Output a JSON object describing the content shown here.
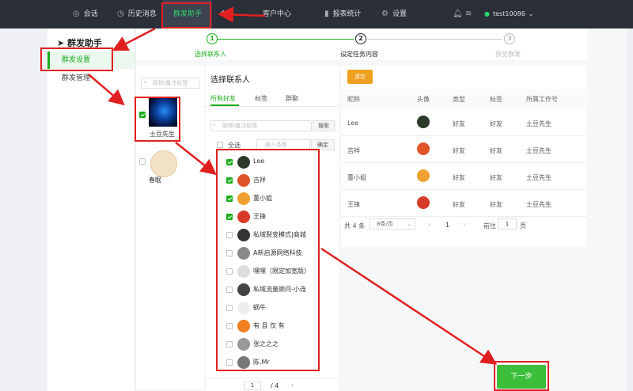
{
  "topbar": {
    "nav": [
      {
        "label": "会话",
        "icon": "chat-icon"
      },
      {
        "label": "历史消息",
        "icon": "clock-icon"
      },
      {
        "label": "群发助手",
        "icon": ""
      },
      {
        "label": "客户中心",
        "icon": "settings-icon"
      },
      {
        "label": "报表统计",
        "icon": "bar-chart-icon"
      },
      {
        "label": "设置",
        "icon": "gear-icon"
      }
    ],
    "username": "test10086"
  },
  "sidebar": {
    "title": "群发助手",
    "items": [
      {
        "label": "群发设置",
        "selected": true
      },
      {
        "label": "群发管理",
        "selected": false
      }
    ]
  },
  "steps": [
    {
      "num": "1",
      "label": "选择联系人",
      "state": "done"
    },
    {
      "num": "2",
      "label": "设定任务内容",
      "state": "active"
    },
    {
      "num": "3",
      "label": "预览群发",
      "state": "todo"
    }
  ],
  "accounts": {
    "search_placeholder": "昵称/备注标签",
    "items": [
      {
        "name": "土豆先生",
        "checked": true
      },
      {
        "name": "春眠",
        "checked": false
      }
    ]
  },
  "contacts": {
    "title": "选择联系人",
    "tabs": [
      "所有好友",
      "标签",
      "群聊"
    ],
    "search_placeholder": "昵称/备注标签",
    "search_button": "搜索",
    "select_all": "全选",
    "count_placeholder": "输入条数",
    "confirm_button": "确定",
    "list": [
      {
        "name": "Lee",
        "checked": true,
        "color": "#2b3a2b"
      },
      {
        "name": "吉祥",
        "checked": true,
        "color": "#e0542a"
      },
      {
        "name": "董小姐",
        "checked": true,
        "color": "#f0a030"
      },
      {
        "name": "王锋",
        "checked": true,
        "color": "#d83a2a"
      },
      {
        "name": "私域裂变模式|商城",
        "checked": false,
        "color": "#333333"
      },
      {
        "name": "A新启源网络科技",
        "checked": false,
        "color": "#8a8a8a"
      },
      {
        "name": "嘿嘿（限定加宽版）",
        "checked": false,
        "color": "#dddddd"
      },
      {
        "name": "私域流量顾问-小连",
        "checked": false,
        "color": "#444444"
      },
      {
        "name": "蜗牛",
        "checked": false,
        "color": "#eeeeee"
      },
      {
        "name": "有 且 仅 有",
        "checked": false,
        "color": "#f08020"
      },
      {
        "name": "张之之之",
        "checked": false,
        "color": "#999999"
      },
      {
        "name": "陈.Mr",
        "checked": false,
        "color": "#777777"
      }
    ],
    "pager_current": "1",
    "pager_total": "/ 4"
  },
  "selected": {
    "clear_button": "清空",
    "headers": [
      "昵称",
      "头像",
      "类型",
      "标签",
      "所属工作号"
    ],
    "rows": [
      {
        "nick": "Lee",
        "type": "好友",
        "tag": "好友",
        "owner": "土豆先生",
        "color": "#2b3a2b"
      },
      {
        "nick": "吉祥",
        "type": "好友",
        "tag": "好友",
        "owner": "土豆先生",
        "color": "#e0542a"
      },
      {
        "nick": "董小姐",
        "type": "好友",
        "tag": "好友",
        "owner": "土豆先生",
        "color": "#f0a030"
      },
      {
        "nick": "王锋",
        "type": "好友",
        "tag": "好友",
        "owner": "土豆先生",
        "color": "#d83a2a"
      }
    ],
    "total": "共 4 条",
    "page_size": "8条/页",
    "page_current": "1",
    "goto_label": "前往",
    "goto_value": "1",
    "goto_suffix": "页"
  },
  "next_button": "下一步",
  "colors": {
    "accent": "#1aad19",
    "annotation": "#e02020",
    "topbar": "#2b2f38"
  }
}
